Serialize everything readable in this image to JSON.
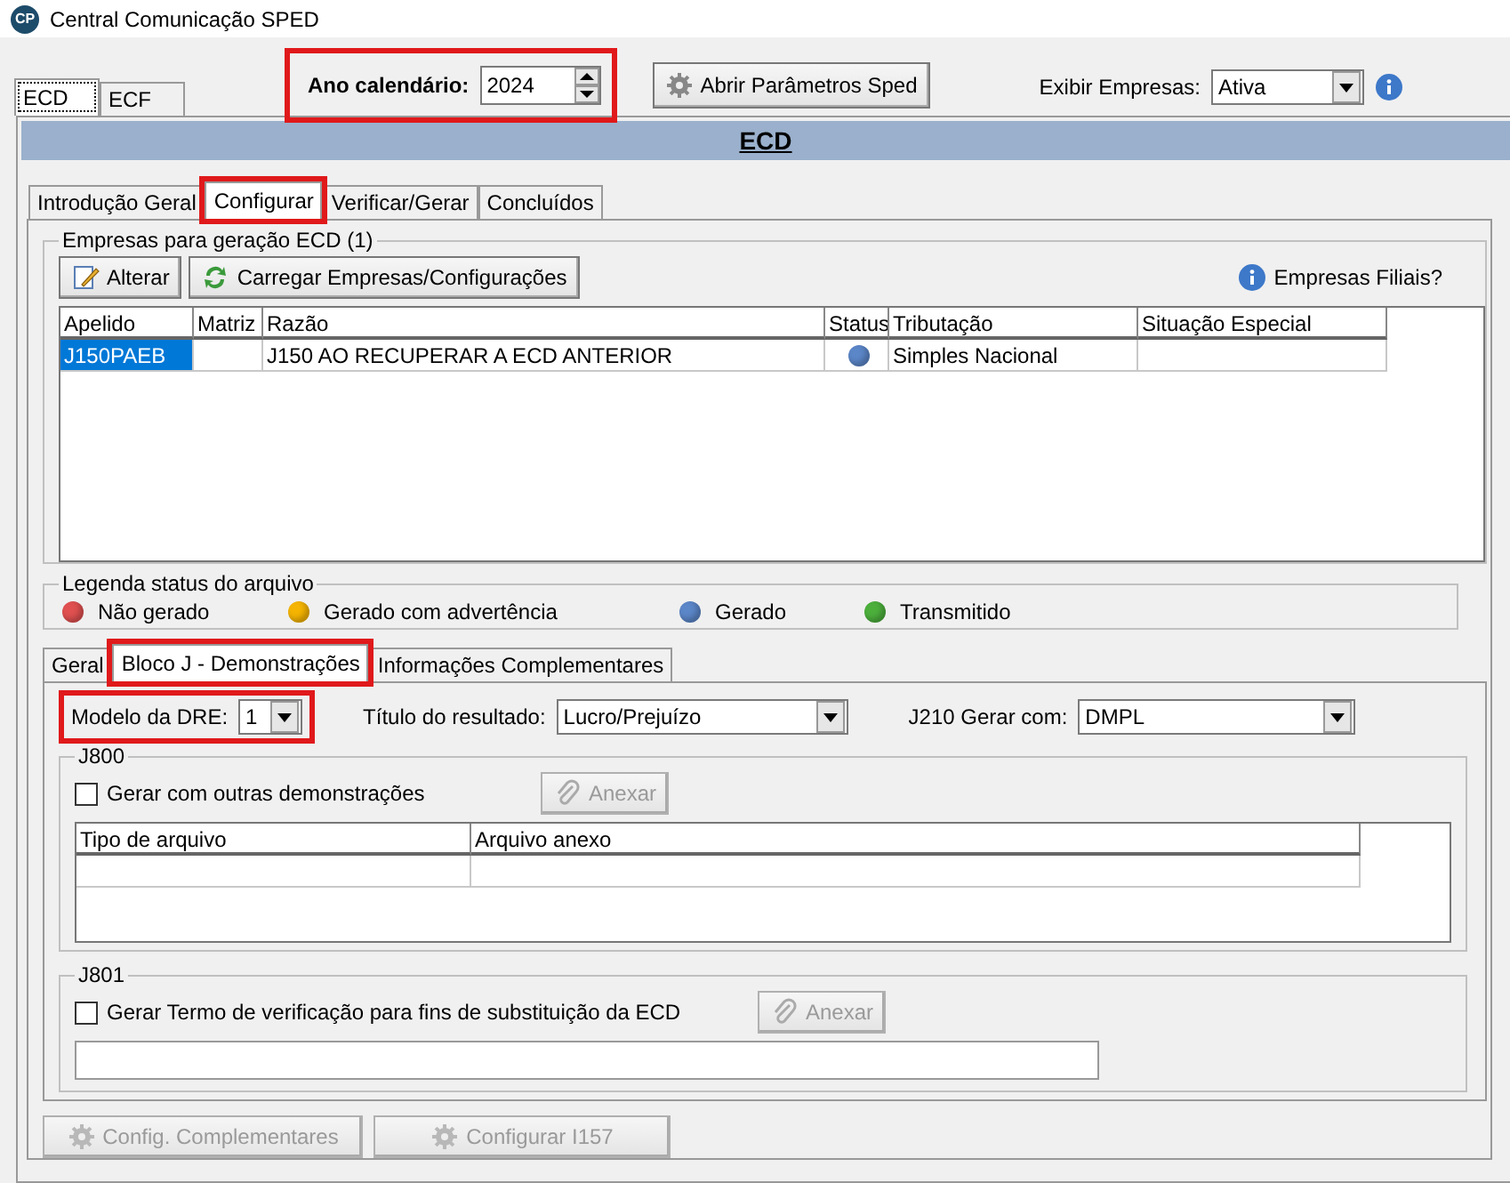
{
  "window": {
    "title": "Central Comunicação SPED",
    "logo": "CP"
  },
  "outer_tabs": [
    {
      "label": "ECD",
      "selected": true
    },
    {
      "label": "ECF",
      "selected": false
    }
  ],
  "year": {
    "label": "Ano calendário:",
    "value": "2024",
    "highlighted": true
  },
  "params_button": {
    "label": "Abrir Parâmetros Sped",
    "disabled": false
  },
  "show_companies": {
    "label": "Exibir Empresas:",
    "value": "Ativa"
  },
  "header": {
    "title": "ECD"
  },
  "tabs": [
    {
      "label": "Introdução Geral",
      "selected": false,
      "highlighted": false
    },
    {
      "label": "Configurar",
      "selected": true,
      "highlighted": true
    },
    {
      "label": "Verificar/Gerar",
      "selected": false,
      "highlighted": false
    },
    {
      "label": "Concluídos",
      "selected": false,
      "highlighted": false
    }
  ],
  "companies": {
    "title": "Empresas para geração ECD (1)",
    "buttons": [
      {
        "label": "Alterar",
        "kind": "edit"
      },
      {
        "label": "Carregar Empresas/Configurações",
        "kind": "reload"
      }
    ],
    "info": "Empresas Filiais?",
    "table": {
      "columns": [
        "Apelido",
        "Matriz",
        "Razão",
        "Status",
        "Tributação",
        "Situação Especial"
      ],
      "rows": [
        {
          "selected": true,
          "cells": [
            "J150PAEB",
            "",
            "J150 AO RECUPERAR A ECD ANTERIOR",
            "",
            "Simples Nacional",
            ""
          ],
          "color": "#5b86c8"
        }
      ]
    }
  },
  "legend": {
    "title": "Legenda status do arquivo",
    "items": [
      {
        "label": "Não gerado",
        "color": "#e05050"
      },
      {
        "label": "Gerado com advertência",
        "color": "#f5b400"
      },
      {
        "label": "Gerado",
        "color": "#5b86c8"
      },
      {
        "label": "Transmitido",
        "color": "#4caf3c"
      }
    ]
  },
  "sub_tabs": [
    {
      "label": "Geral",
      "selected": false,
      "highlighted": false
    },
    {
      "label": "Bloco J - Demonstrações",
      "selected": true,
      "highlighted": true
    },
    {
      "label": "Informações Complementares",
      "selected": false,
      "highlighted": false
    }
  ],
  "options": [
    {
      "label": "Modelo da DRE:",
      "value": "1",
      "highlighted": true
    },
    {
      "label": "Título do resultado:",
      "value": "Lucro/Prejuízo",
      "highlighted": false
    },
    {
      "label": "J210 Gerar com:",
      "value": "DMPL",
      "highlighted": false
    }
  ],
  "j800": {
    "title": "J800",
    "checkbox": {
      "label": "Gerar com outras demonstrações",
      "checked": false
    },
    "attach": {
      "label": "Anexar",
      "disabled": true
    },
    "columns": [
      "Tipo de arquivo",
      "Arquivo anexo"
    ]
  },
  "j801": {
    "title": "J801",
    "checkbox": {
      "label": "Gerar Termo de verificação para fins de substituição da ECD",
      "checked": false
    },
    "attach": {
      "label": "Anexar",
      "disabled": true
    }
  },
  "bottom_buttons": [
    {
      "label": "Config. Complementares",
      "disabled": true
    },
    {
      "label": "Configurar I157",
      "disabled": true
    }
  ]
}
